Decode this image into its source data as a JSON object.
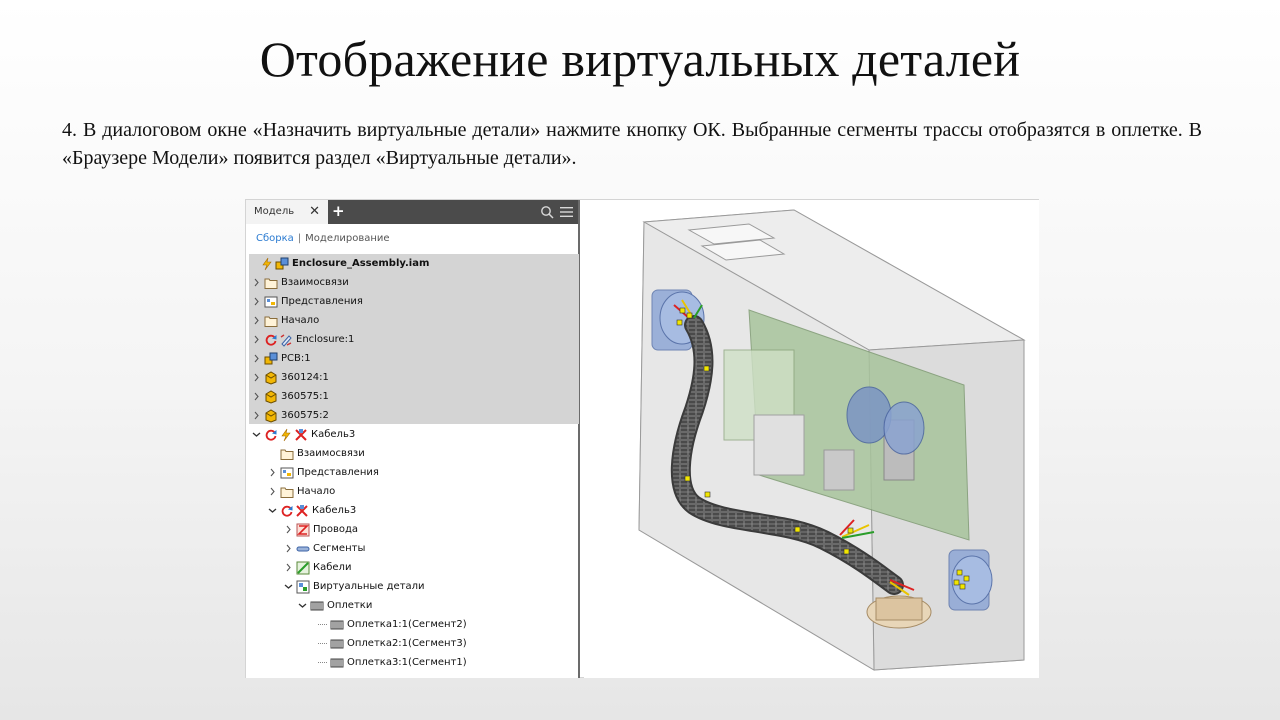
{
  "slide": {
    "title": "Отображение виртуальных деталей",
    "text": "4. В диалоговом окне «Назначить виртуальные детали» нажмите кнопку ОК. Выбранные сегменты трассы отобразятся в оплетке. В «Браузере Модели» появится раздел «Виртуальные детали»."
  },
  "browser": {
    "tab_label": "Модель",
    "close_symbol": "✕",
    "add_symbol": "+",
    "subtab_active": "Сборка",
    "subtab_separator": "|",
    "subtab_other": "Моделирование",
    "tree": [
      {
        "label": "Enclosure_Assembly.iam",
        "icon": "assembly-icon",
        "bold": true
      },
      {
        "label": "Взаимосвязи",
        "icon": "folder-icon"
      },
      {
        "label": "Представления",
        "icon": "representations-icon"
      },
      {
        "label": "Начало",
        "icon": "folder-icon"
      },
      {
        "label": "Enclosure:1",
        "icon": "part-link-icon"
      },
      {
        "label": "PCB:1",
        "icon": "assembly-icon"
      },
      {
        "label": "360124:1",
        "icon": "part-icon"
      },
      {
        "label": "360575:1",
        "icon": "part-icon"
      },
      {
        "label": "360575:2",
        "icon": "part-icon"
      },
      {
        "label": "Кабель3",
        "icon": "harness-icon"
      },
      {
        "label": "Взаимосвязи",
        "icon": "folder-icon"
      },
      {
        "label": "Представления",
        "icon": "representations-icon"
      },
      {
        "label": "Начало",
        "icon": "folder-icon"
      },
      {
        "label": "Кабель3",
        "icon": "harness-icon"
      },
      {
        "label": "Провода",
        "icon": "wires-icon"
      },
      {
        "label": "Сегменты",
        "icon": "segments-icon"
      },
      {
        "label": "Кабели",
        "icon": "cables-icon"
      },
      {
        "label": "Виртуальные детали",
        "icon": "virtual-parts-icon"
      },
      {
        "label": "Оплетки",
        "icon": "braid-icon"
      },
      {
        "label": "Оплетка1:1(Сегмент2)",
        "icon": "braid-icon"
      },
      {
        "label": "Оплетка2:1(Сегмент3)",
        "icon": "braid-icon"
      },
      {
        "label": "Оплетка3:1(Сегмент1)",
        "icon": "braid-icon"
      }
    ]
  },
  "colors": {
    "tabbar": "#4b4b4b",
    "selection": "#d4d4d4",
    "link": "#2b7bd1",
    "part_yellow": "#f2b705",
    "cable_gray": "#5a5a5a"
  }
}
